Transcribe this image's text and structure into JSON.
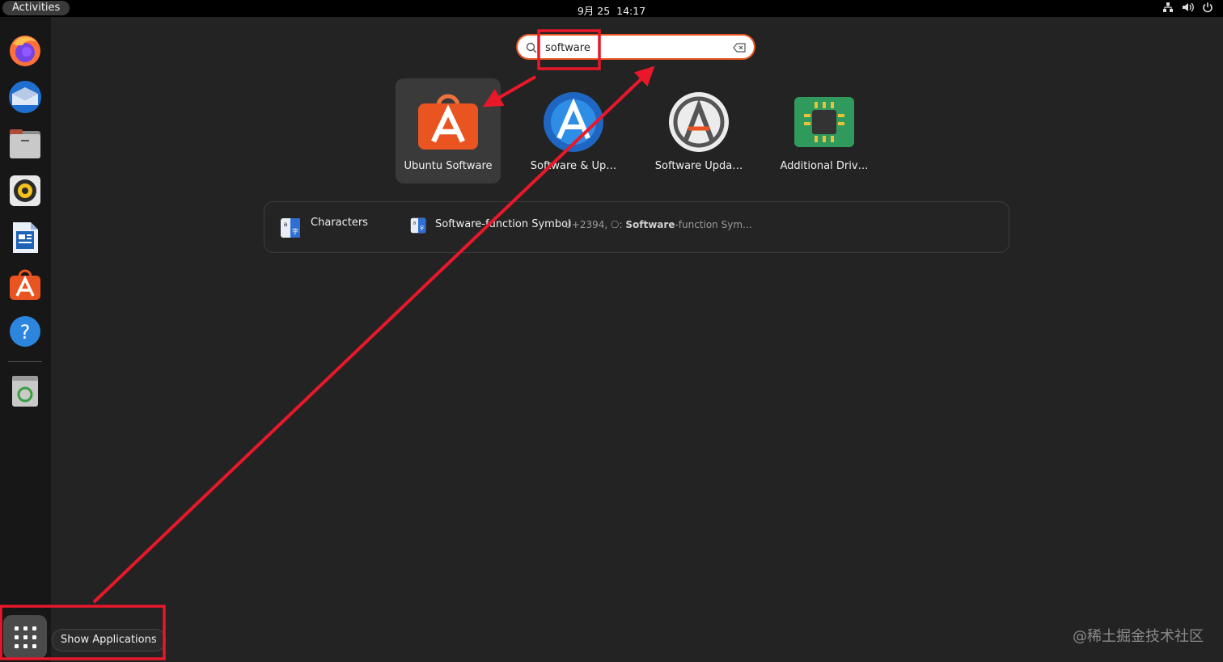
{
  "topbar": {
    "activities": "Activities",
    "date": "9月 25",
    "time": "14:17"
  },
  "dock": {
    "items": [
      "firefox-icon",
      "thunderbird-icon",
      "files-icon",
      "rhythmbox-icon",
      "writer-icon",
      "ubuntu-software-icon",
      "help-icon",
      "trash-icon"
    ],
    "show_apps_tooltip": "Show Applications"
  },
  "search": {
    "value": "software"
  },
  "results": {
    "apps": [
      {
        "label": "Ubuntu Software",
        "icon": "ubuntu-software-icon",
        "selected": true
      },
      {
        "label": "Software & Up…",
        "icon": "software-updates-icon",
        "selected": false
      },
      {
        "label": "Software Upda…",
        "icon": "software-updater-icon",
        "selected": false
      },
      {
        "label": "Additional Driv…",
        "icon": "additional-drivers-icon",
        "selected": false
      }
    ],
    "provider": {
      "name": "Characters",
      "result_title": "Software-function Symbol",
      "result_code": "U+2394, ⎔: ",
      "result_bold": "Software",
      "result_rest": "-function Sym…"
    }
  },
  "watermark": "@稀土掘金技术社区",
  "colors": {
    "accent": "#e95420",
    "annotation": "#e8182a"
  }
}
